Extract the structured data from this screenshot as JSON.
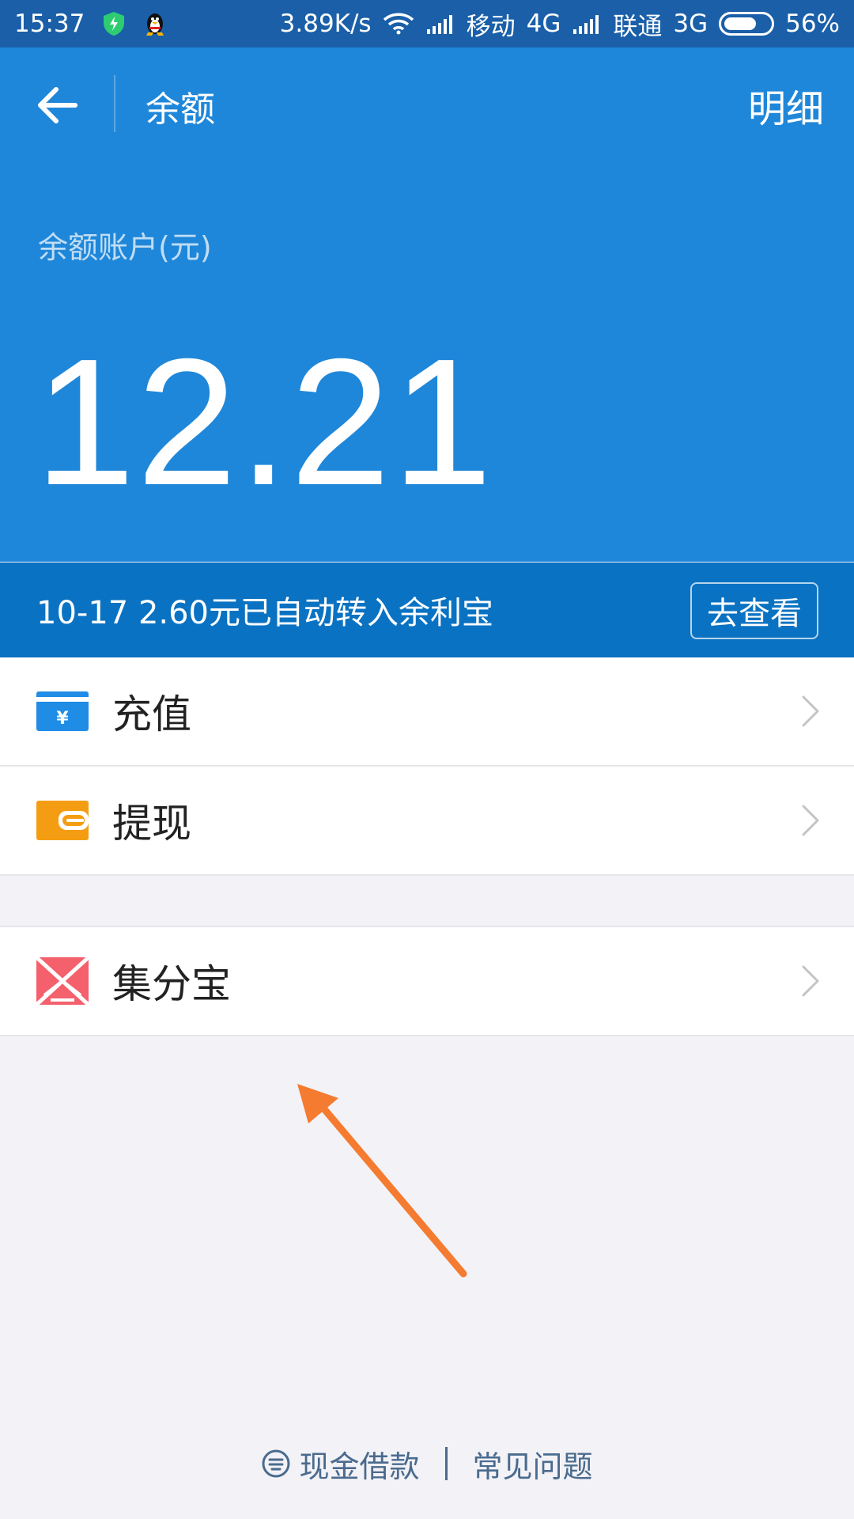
{
  "status_bar": {
    "time": "15:37",
    "net_speed": "3.89K/s",
    "carrier1": "移动",
    "net1": "4G",
    "carrier2": "联通",
    "net2": "3G",
    "battery": "56%"
  },
  "header": {
    "title": "余额",
    "detail_label": "明细",
    "account_label": "余额账户(元)",
    "balance": "12.21"
  },
  "notice": {
    "text": "10-17 2.60元已自动转入余利宝",
    "button": "去查看"
  },
  "menu": {
    "recharge": "充值",
    "withdraw": "提现",
    "jifenbao": "集分宝"
  },
  "footer": {
    "cash_loan": "现金借款",
    "faq": "常见问题"
  },
  "colors": {
    "header_bg": "#1f87d9",
    "notice_bg": "#0a72c2",
    "arrow": "#f47b30"
  }
}
